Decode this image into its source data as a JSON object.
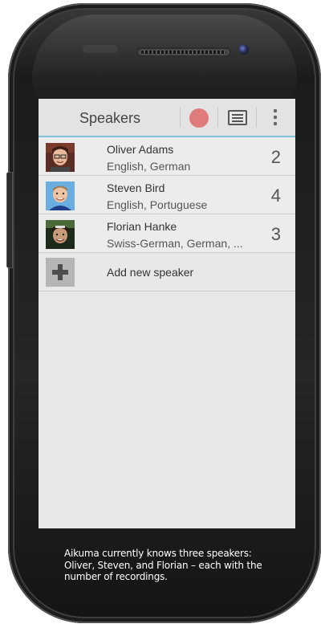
{
  "action_bar": {
    "title": "Speakers"
  },
  "speakers": [
    {
      "name": "Oliver Adams",
      "languages": "English, German",
      "recordings": "2"
    },
    {
      "name": "Steven Bird",
      "languages": "English, Portuguese",
      "recordings": "4"
    },
    {
      "name": "Florian Hanke",
      "languages": "Swiss-German, German, ...",
      "recordings": "3"
    }
  ],
  "add_speaker_label": "Add new speaker",
  "caption": "Aikuma currently knows three speakers: Oliver, Steven, and Florian – each with the number of recordings.",
  "colors": {
    "accent_line": "#7fc4da",
    "record": "#e07b7b",
    "screen_bg": "#e8e8e8"
  },
  "icons": {
    "record": "record-icon",
    "recordings_list": "list-icon",
    "overflow": "overflow-menu-icon",
    "add": "plus-icon"
  }
}
